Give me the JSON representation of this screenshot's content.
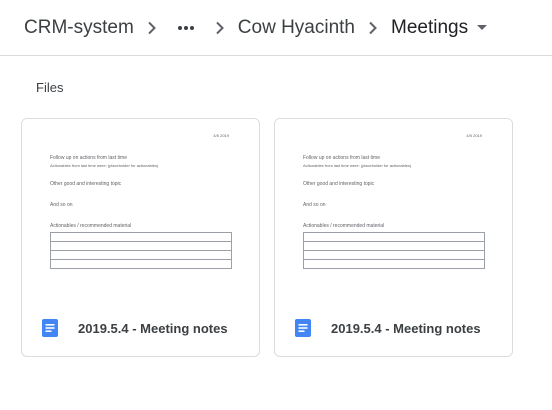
{
  "breadcrumb": {
    "root": "CRM-system",
    "folder": "Cow Hyacinth",
    "current": "Meetings"
  },
  "section": {
    "label": "Files"
  },
  "files": [
    {
      "name": "2019.5.4 - Meeting notes",
      "preview": {
        "date": "4/5 2019",
        "line1": "Follow up on actions from last time",
        "line2": "Actionables from last time were: (placeholder for actionables)",
        "line3": "Other good and interesting topic",
        "line4": "And so on",
        "line5": "Actionables / recommended material"
      }
    },
    {
      "name": "2019.5.4 - Meeting notes",
      "preview": {
        "date": "4/5 2019",
        "line1": "Follow up on actions from last time",
        "line2": "Actionables from last time were: (placeholder for actionables)",
        "line3": "Other good and interesting topic",
        "line4": "And so on",
        "line5": "Actionables / recommended material"
      }
    }
  ],
  "icons": {
    "separator": "chevron-right-icon",
    "more": "more-horiz-icon",
    "dropdown": "arrow-drop-down-icon",
    "file": "google-docs-icon"
  },
  "colors": {
    "docs_blue": "#4285f4",
    "divider": "#dadce0",
    "text": "#3c4043"
  }
}
